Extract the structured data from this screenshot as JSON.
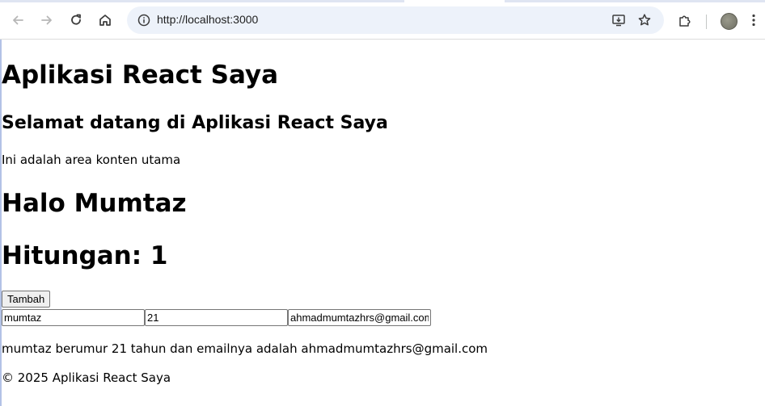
{
  "browser": {
    "url": "http://localhost:3000",
    "icons": {
      "back": "arrow-left-icon",
      "forward": "arrow-right-icon",
      "reload": "reload-icon",
      "home": "home-icon",
      "site_info": "info-icon",
      "install": "install-app-icon",
      "bookmark": "star-icon",
      "extensions": "puzzle-icon",
      "menu": "kebab-menu-icon"
    }
  },
  "page": {
    "title": "Aplikasi React Saya",
    "welcome": "Selamat datang di Aplikasi React Saya",
    "content_text": "Ini adalah area konten utama",
    "greeting": "Halo Mumtaz",
    "counter": "Hitungan: 1",
    "add_button_label": "Tambah",
    "form": {
      "name_value": "mumtaz",
      "age_value": "21",
      "email_value": "ahmadmumtazhrs@gmail.com"
    },
    "summary": "mumtaz berumur 21 tahun dan emailnya adalah ahmadmumtazhrs@gmail.com",
    "footer": "© 2025 Aplikasi React Saya"
  }
}
